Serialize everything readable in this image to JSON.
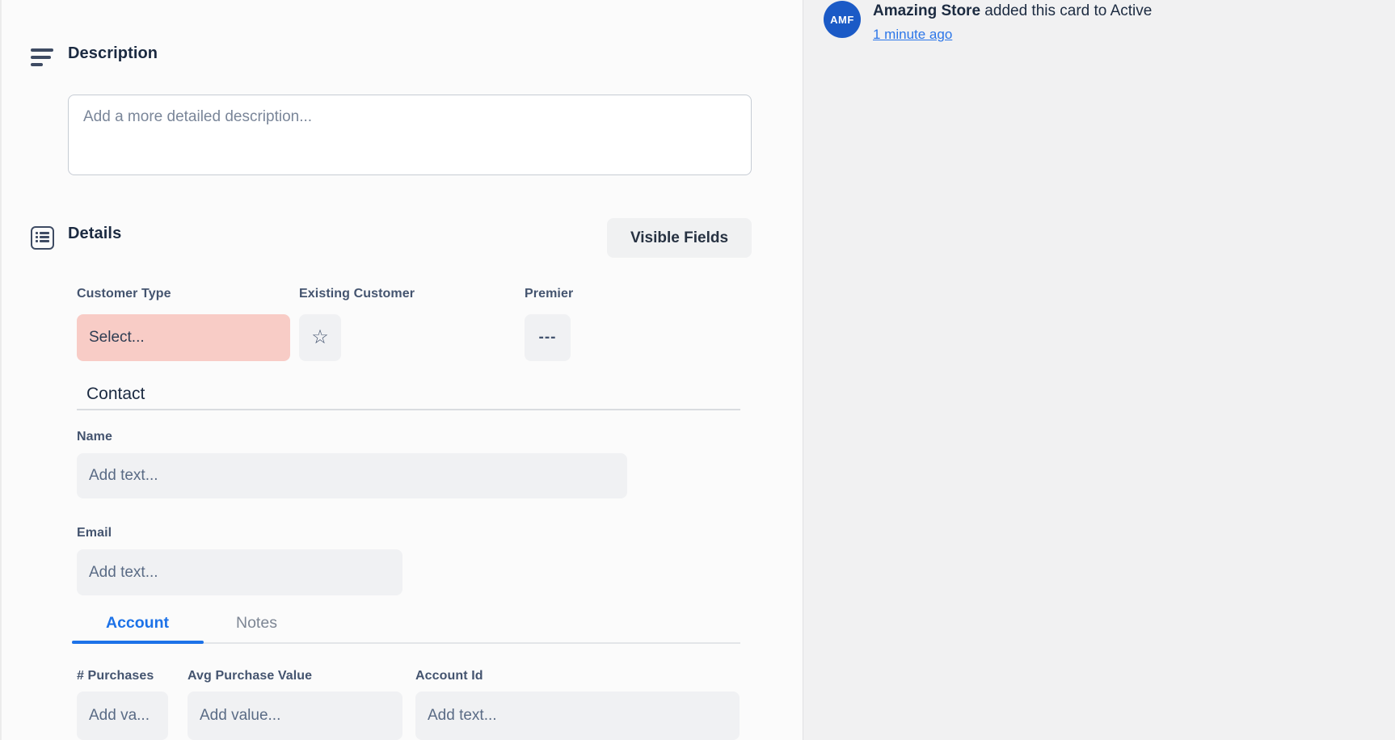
{
  "description": {
    "title": "Description",
    "placeholder": "Add a more detailed description..."
  },
  "details": {
    "title": "Details",
    "visible_fields_button": "Visible Fields",
    "fields": [
      {
        "label": "Customer Type",
        "type": "select",
        "value": "Select...",
        "highlight_color": "#f8ccc6"
      },
      {
        "label": "Existing Customer",
        "type": "checkbox",
        "icon": "star-icon",
        "icon_glyph": "☆",
        "checked": false
      },
      {
        "label": "Premier",
        "type": "select",
        "value": "---"
      }
    ]
  },
  "contact": {
    "title": "Contact",
    "fields": [
      {
        "label": "Name",
        "placeholder": "Add text...",
        "value": ""
      },
      {
        "label": "Email",
        "placeholder": "Add text...",
        "value": ""
      }
    ]
  },
  "tabs": [
    {
      "label": "Account",
      "active": true
    },
    {
      "label": "Notes",
      "active": false
    }
  ],
  "account_fields": [
    {
      "label": "# Purchases",
      "placeholder": "Add va...",
      "value": ""
    },
    {
      "label": "Avg Purchase Value",
      "placeholder": "Add value...",
      "value": ""
    },
    {
      "label": "Account Id",
      "placeholder": "Add text...",
      "value": ""
    }
  ],
  "activity": {
    "avatar_initials": "AMF",
    "actor": "Amazing Store",
    "action": " added this card to Active",
    "timestamp": "1 minute ago"
  },
  "colors": {
    "accent_blue": "#1d72e8",
    "link_blue": "#2c76e8",
    "avatar_blue": "#1b5ac6",
    "select_warning_pink": "#f8ccc6",
    "field_gray": "#f0f1f3",
    "panel_gray": "#f1f1f2",
    "label_slate": "#44546f",
    "heading_dark": "#1b2a41"
  }
}
